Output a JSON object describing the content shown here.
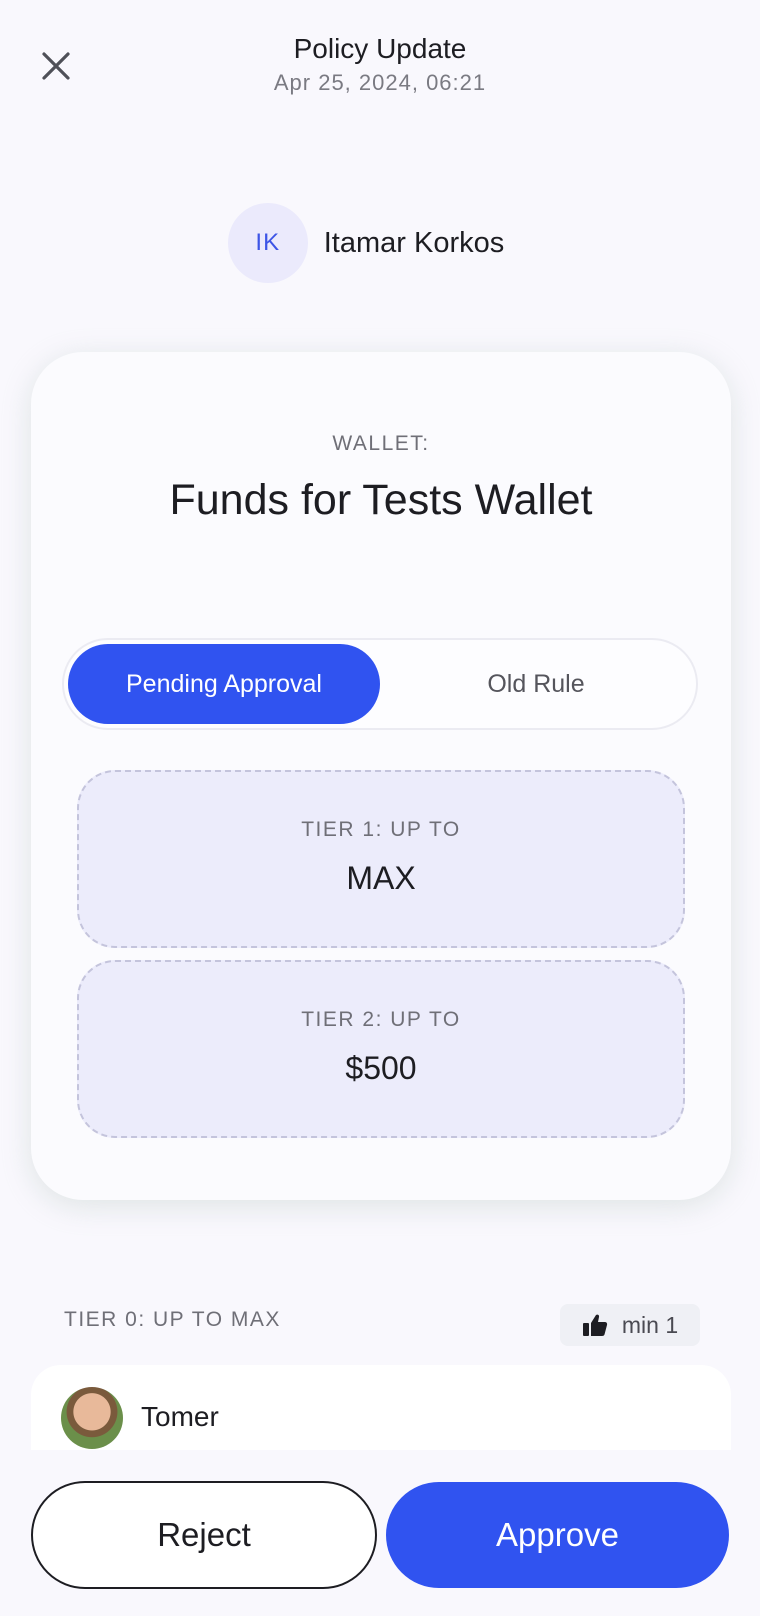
{
  "header": {
    "title": "Policy Update",
    "date": "Apr 25, 2024, 06:21"
  },
  "user": {
    "initials": "IK",
    "name": "Itamar Korkos"
  },
  "wallet": {
    "label": "WALLET:",
    "name": "Funds for Tests Wallet"
  },
  "segments": {
    "pending": "Pending Approval",
    "old": "Old Rule",
    "selected": "Pending Approval"
  },
  "tiers": [
    {
      "label": "TIER 1: UP TO",
      "value": "MAX"
    },
    {
      "label": "TIER 2: UP TO",
      "value": "$500"
    }
  ],
  "tier0": {
    "label": "TIER 0: UP TO MAX",
    "min_label": "min 1",
    "approvers": [
      {
        "name": "Tomer"
      }
    ]
  },
  "actions": {
    "reject": "Reject",
    "approve": "Approve"
  },
  "colors": {
    "accent": "#3053f0",
    "tier_bg": "#ececfb",
    "initials_bg": "#ebeafc"
  },
  "icons": {
    "close": "close-icon",
    "thumb": "thumbs-up-icon"
  }
}
